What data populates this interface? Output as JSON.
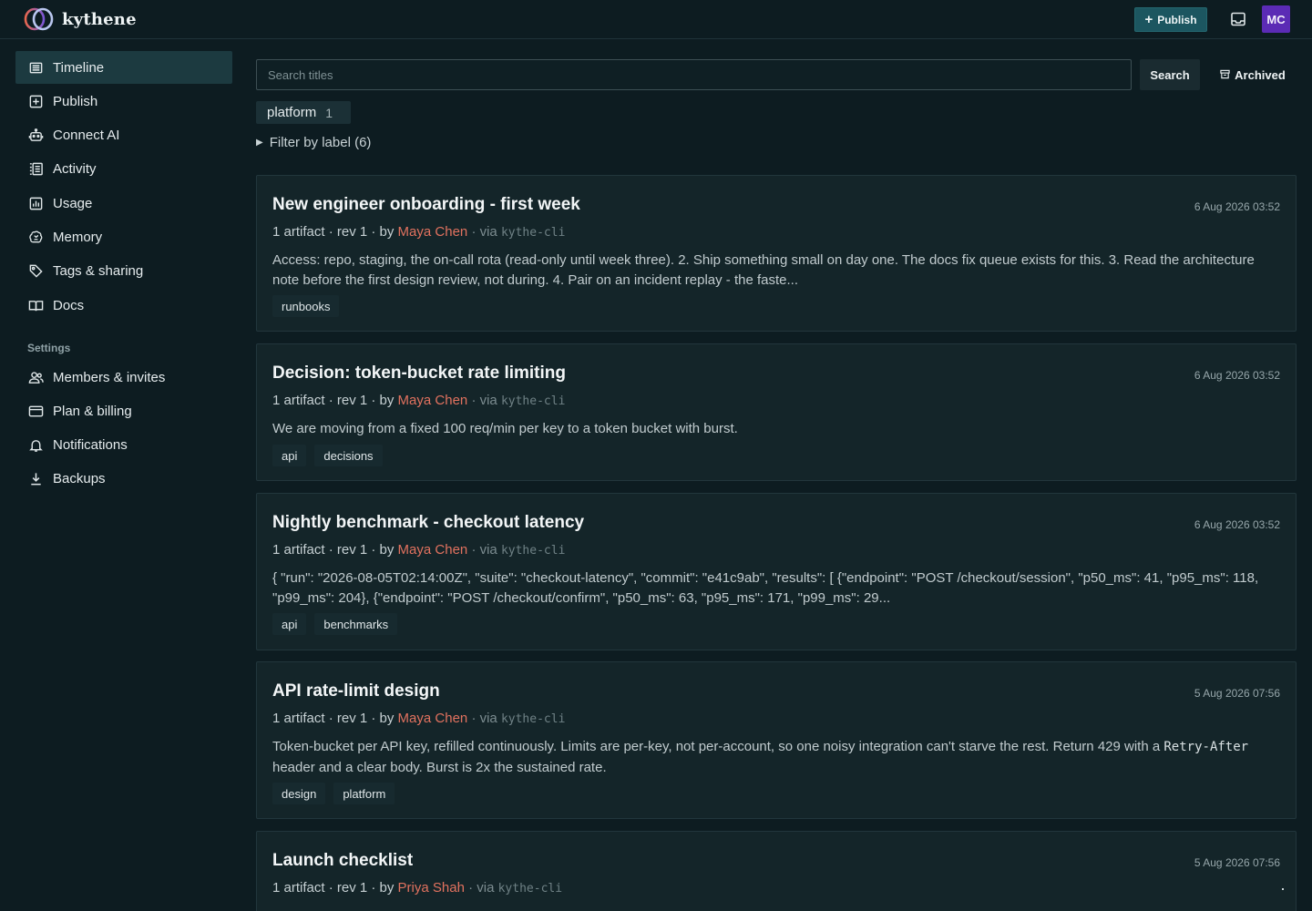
{
  "header": {
    "brand": "kythene",
    "publish_button": "Publish",
    "avatar_initials": "MC"
  },
  "sidebar": {
    "items": [
      {
        "label": "Timeline",
        "icon": "timeline-icon",
        "active": true
      },
      {
        "label": "Publish",
        "icon": "plus-square-icon"
      },
      {
        "label": "Connect AI",
        "icon": "robot-icon"
      },
      {
        "label": "Activity",
        "icon": "activity-list-icon"
      },
      {
        "label": "Usage",
        "icon": "bar-chart-icon"
      },
      {
        "label": "Memory",
        "icon": "brain-icon"
      },
      {
        "label": "Tags & sharing",
        "icon": "tag-icon"
      },
      {
        "label": "Docs",
        "icon": "book-icon"
      }
    ],
    "settings_heading": "Settings",
    "settings_items": [
      {
        "label": "Members & invites",
        "icon": "users-icon"
      },
      {
        "label": "Plan & billing",
        "icon": "credit-card-icon"
      },
      {
        "label": "Notifications",
        "icon": "bell-icon"
      },
      {
        "label": "Backups",
        "icon": "download-icon"
      }
    ]
  },
  "search": {
    "placeholder": "Search titles",
    "button": "Search",
    "archived_button": "Archived"
  },
  "active_filter": {
    "label": "platform",
    "count": "1"
  },
  "filter_toggle": "Filter by label (6)",
  "posts": [
    {
      "title": "New engineer onboarding - first week",
      "date": "6 Aug 2026 03:52",
      "meta_prefix": "1 artifact · rev 1 · by",
      "author": "Maya Chen",
      "via": "· via",
      "source": "kythe-cli",
      "body": "Access: repo, staging, the on-call rota (read-only until week three). 2. Ship something small on day one. The docs fix queue exists for this. 3. Read the architecture note before the first design review, not during. 4. Pair on an incident replay - the faste...",
      "tags": [
        "runbooks"
      ]
    },
    {
      "title": "Decision: token-bucket rate limiting",
      "date": "6 Aug 2026 03:52",
      "meta_prefix": "1 artifact · rev 1 · by",
      "author": "Maya Chen",
      "via": "· via",
      "source": "kythe-cli",
      "body": "We are moving from a fixed 100 req/min per key to a token bucket with burst.",
      "tags": [
        "api",
        "decisions"
      ]
    },
    {
      "title": "Nightly benchmark - checkout latency",
      "date": "6 Aug 2026 03:52",
      "meta_prefix": "1 artifact · rev 1 · by",
      "author": "Maya Chen",
      "via": "· via",
      "source": "kythe-cli",
      "body": "{ \"run\": \"2026-08-05T02:14:00Z\", \"suite\": \"checkout-latency\", \"commit\": \"e41c9ab\", \"results\": [ {\"endpoint\": \"POST /checkout/session\", \"p50_ms\": 41, \"p95_ms\": 118, \"p99_ms\": 204}, {\"endpoint\": \"POST /checkout/confirm\", \"p50_ms\": 63, \"p95_ms\": 171, \"p99_ms\": 29...",
      "tags": [
        "api",
        "benchmarks"
      ]
    },
    {
      "title": "API rate-limit design",
      "date": "5 Aug 2026 07:56",
      "meta_prefix": "1 artifact · rev 1 · by",
      "author": "Maya Chen",
      "via": "· via",
      "source": "kythe-cli",
      "body_before": "Token-bucket per API key, refilled continuously. Limits are per-key, not per-account, so one noisy integration can't starve the rest. Return 429 with a ",
      "body_code": "Retry-After",
      "body_after": " header and a clear body. Burst is 2x the sustained rate.",
      "tags": [
        "design",
        "platform"
      ]
    },
    {
      "title": "Launch checklist",
      "date": "5 Aug 2026 07:56",
      "meta_prefix": "1 artifact · rev 1 · by",
      "author": "Priya Shah",
      "via": "· via",
      "source": "kythe-cli"
    }
  ],
  "colors": {
    "background": "#0d1c21",
    "card": "#142529",
    "accent": "#1c5660",
    "author": "#e2725f",
    "avatar": "#5b2bb5"
  }
}
